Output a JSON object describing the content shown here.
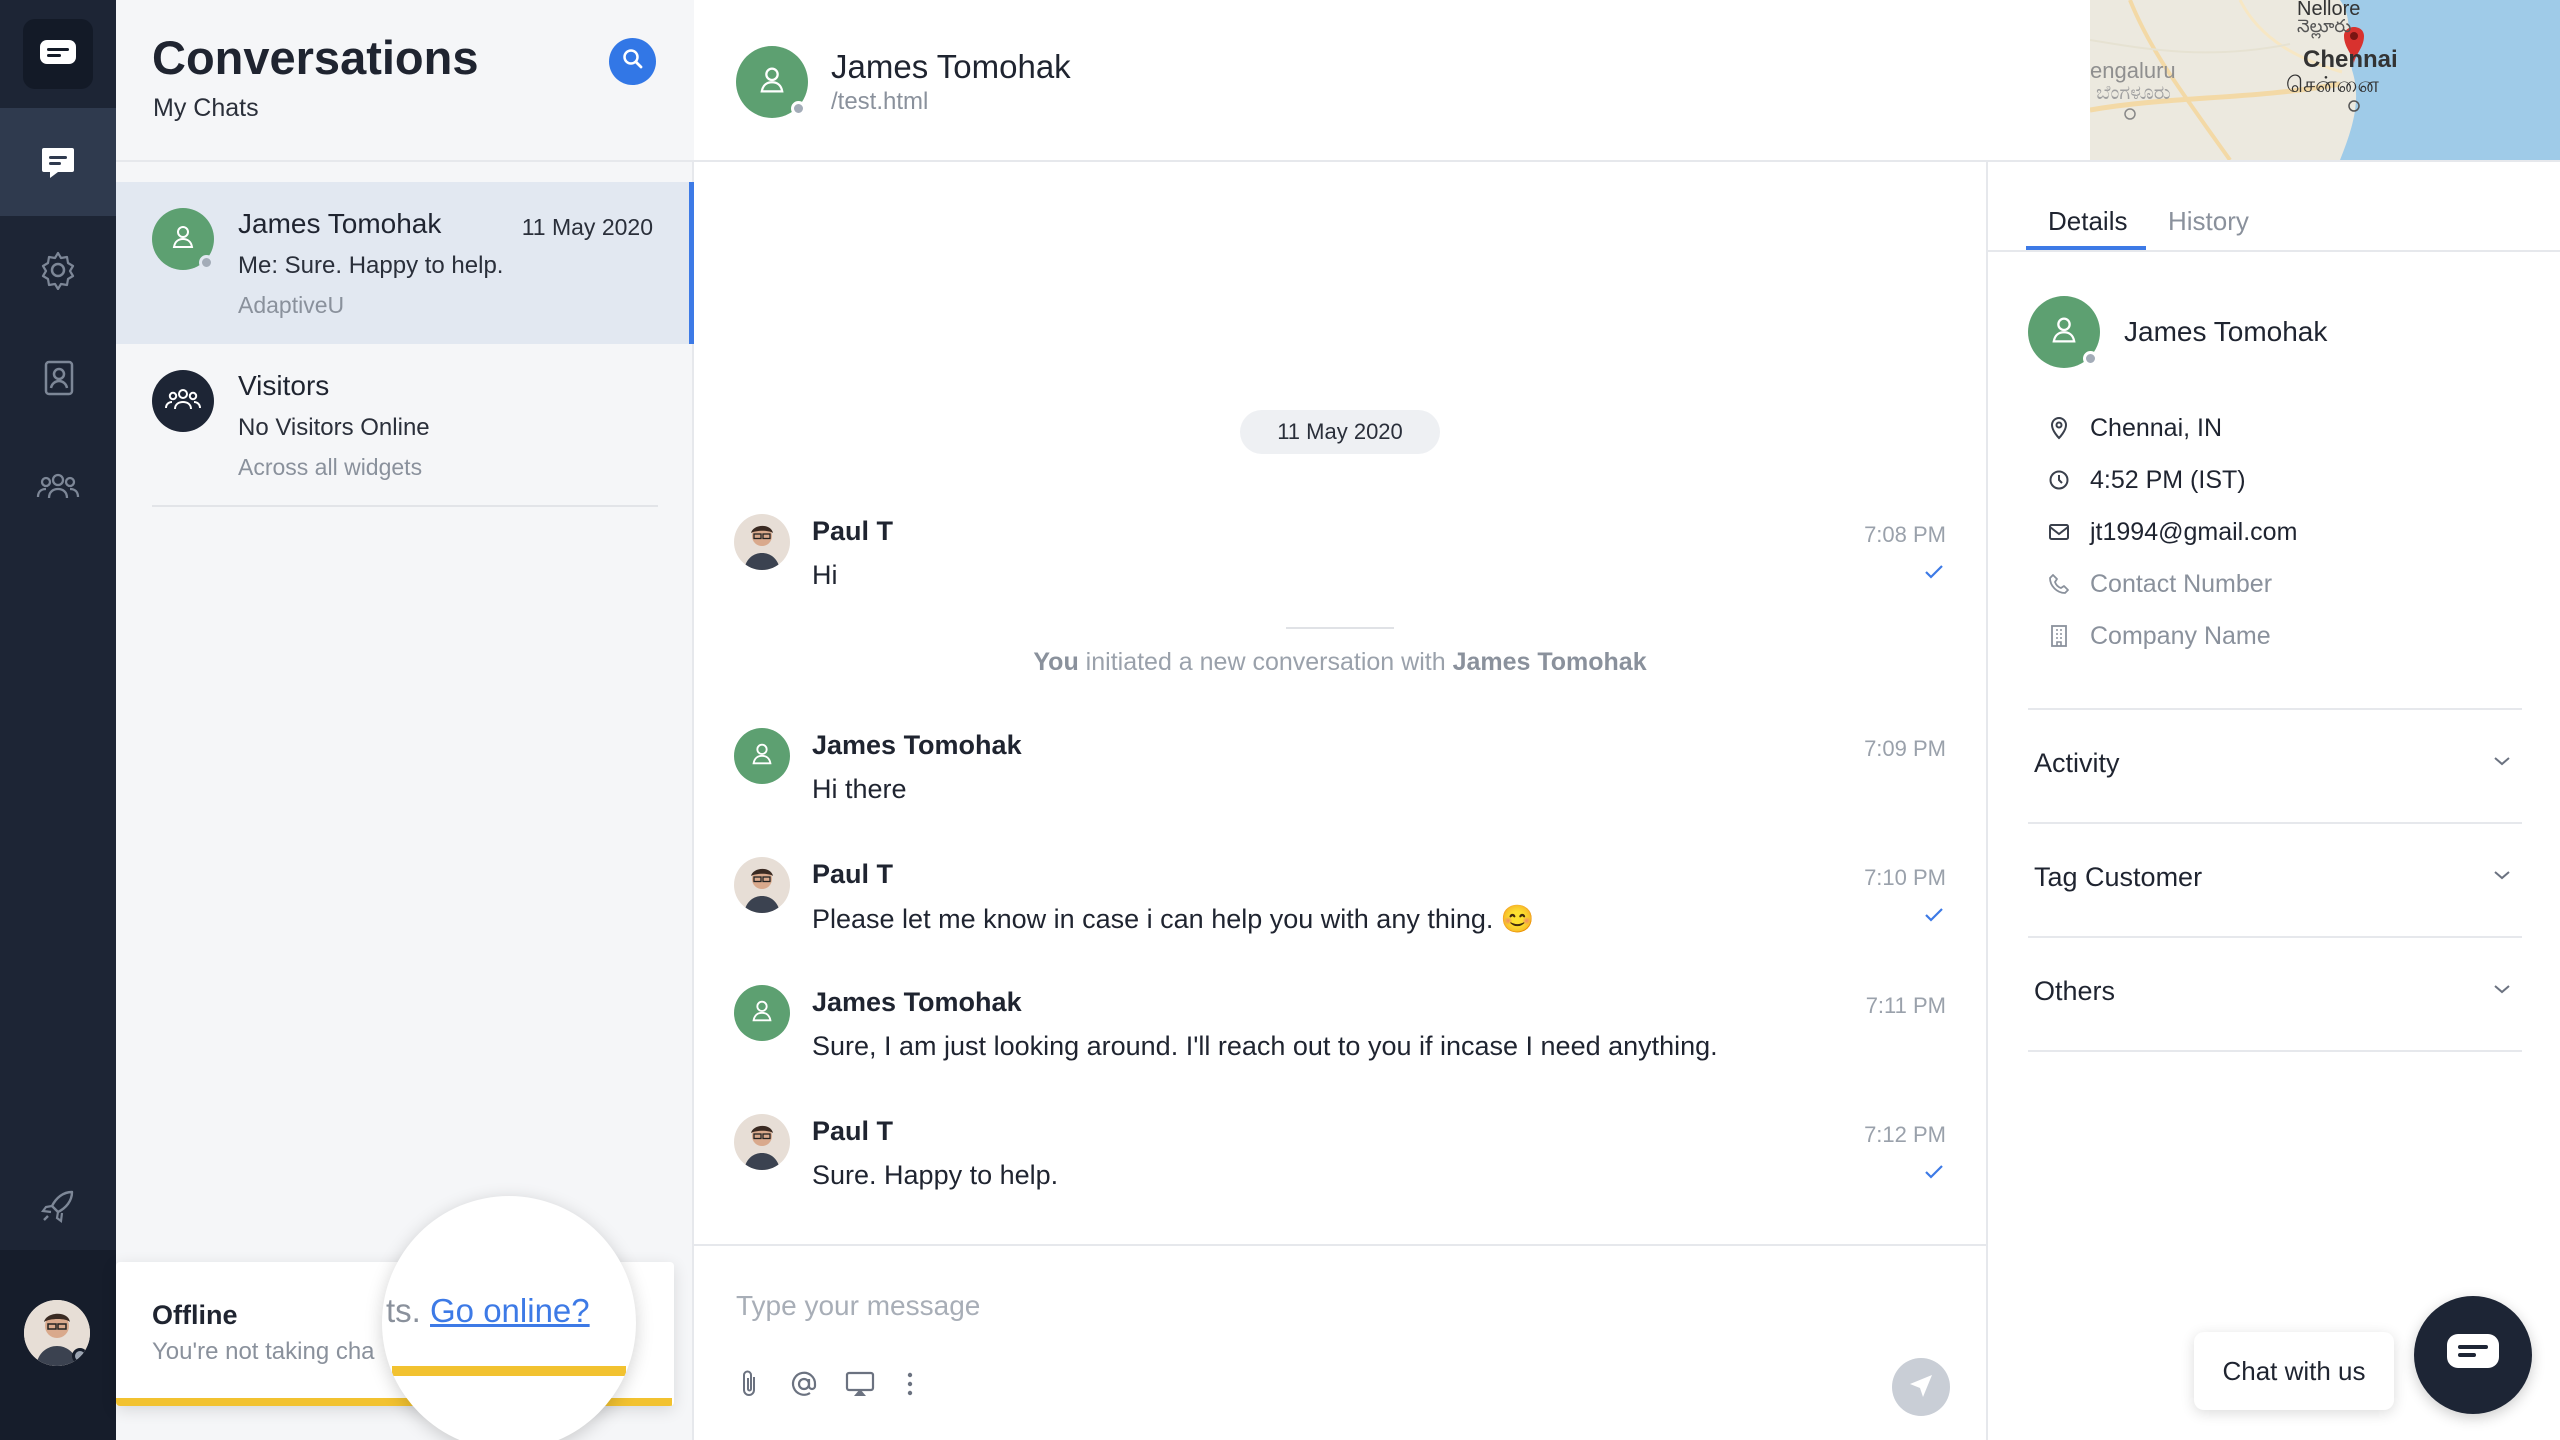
{
  "colors": {
    "rail_bg": "#1d2535",
    "accent": "#3d7ae6",
    "user_avatar_green": "#5da071",
    "offline_bar": "#f2c230",
    "tick_blue": "#3d7ae6"
  },
  "rail": {
    "items": [
      {
        "icon": "app-logo-icon"
      },
      {
        "icon": "chat-icon",
        "active": true
      },
      {
        "icon": "gear-icon"
      },
      {
        "icon": "contacts-book-icon"
      },
      {
        "icon": "team-icon"
      },
      {
        "icon": "rocket-icon"
      }
    ]
  },
  "conversations": {
    "title": "Conversations",
    "subtitle": "My Chats",
    "items": [
      {
        "name": "James Tomohak",
        "date": "11 May 2020",
        "message": "Me: Sure. Happy to help.",
        "meta": "AdaptiveU"
      },
      {
        "name": "Visitors",
        "date": "",
        "message": "No Visitors Online",
        "meta": "Across all widgets"
      }
    ],
    "offline": {
      "title": "Offline",
      "subtitle": "You're not taking cha",
      "magnifier_prefix": "ts. ",
      "magnifier_link": "Go online?"
    }
  },
  "chat": {
    "contact_name": "James Tomohak",
    "contact_path": "/test.html",
    "date_chip": "11 May 2020",
    "system_note": {
      "you": "You",
      "middle": " initiated a new conversation with ",
      "name": "James Tomohak"
    },
    "messages": [
      {
        "sender": "Paul T",
        "text": "Hi",
        "time": "7:08 PM",
        "seen": true,
        "agent": true
      },
      {
        "sender": "James Tomohak",
        "text": "Hi there",
        "time": "7:09 PM",
        "seen": false,
        "agent": false
      },
      {
        "sender": "Paul T",
        "text": "Please let me know in case i can help you with any thing. 😊",
        "time": "7:10 PM",
        "seen": true,
        "agent": true
      },
      {
        "sender": "James Tomohak",
        "text": "Sure, I am just looking around. I'll reach out to you if incase I need anything.",
        "time": "7:11 PM",
        "seen": false,
        "agent": false
      },
      {
        "sender": "Paul T",
        "text": "Sure. Happy to help.",
        "time": "7:12 PM",
        "seen": true,
        "agent": true
      }
    ],
    "composer": {
      "placeholder": "Type your message"
    }
  },
  "map": {
    "labels": [
      "Nellore",
      "నెల్లూరు",
      "engaluru",
      "ಬೆಂಗಳೂರು",
      "Chennai",
      "சென்னை"
    ]
  },
  "details": {
    "tabs": [
      "Details",
      "History"
    ],
    "name": "James Tomohak",
    "location": "Chennai, IN",
    "local_time": "4:52 PM (IST)",
    "email": "jt1994@gmail.com",
    "phone_placeholder": "Contact Number",
    "company_placeholder": "Company Name",
    "sections": [
      "Activity",
      "Tag Customer",
      "Others"
    ]
  },
  "widget": {
    "label": "Chat with us"
  }
}
